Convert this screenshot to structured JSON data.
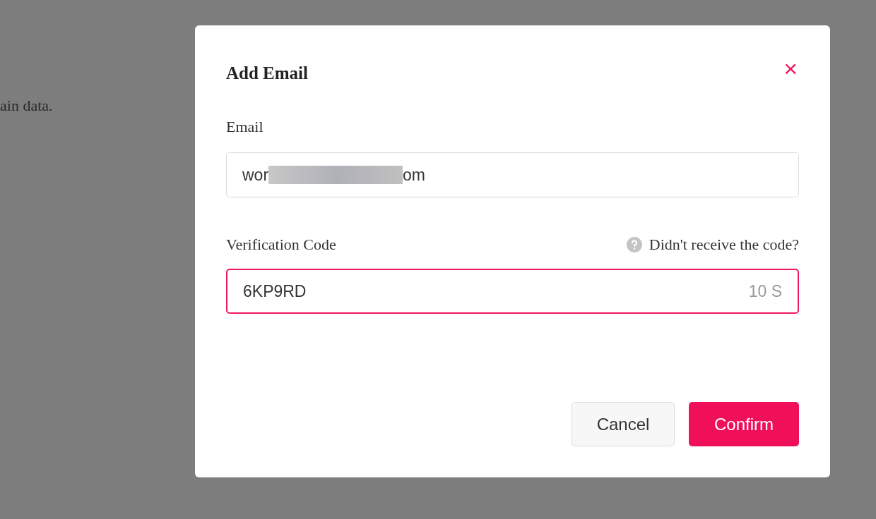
{
  "background": {
    "text": "ain data."
  },
  "dialog": {
    "title": "Add Email",
    "close": "×",
    "email": {
      "label": "Email",
      "value_start": "wor",
      "value_end": "om",
      "redacted": true
    },
    "code": {
      "label": "Verification Code",
      "help": "Didn't receive the code?",
      "value": "6KP9RD",
      "countdown": "10 S",
      "focused": true
    },
    "buttons": [
      {
        "label": "Cancel",
        "kind": "secondary"
      },
      {
        "label": "Confirm",
        "kind": "primary"
      }
    ]
  }
}
